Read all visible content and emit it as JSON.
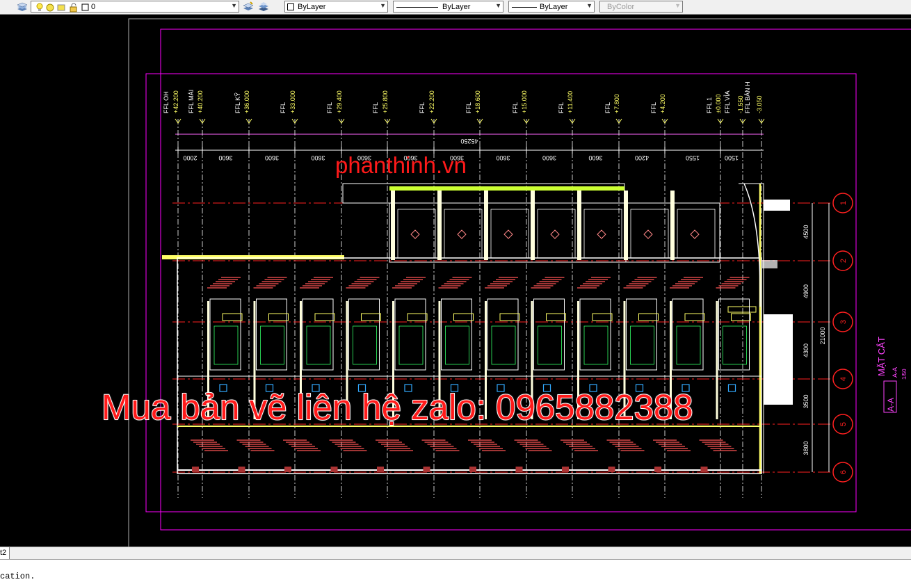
{
  "toolbar": {
    "layer_name": "0",
    "color": "ByLayer",
    "linetype": "ByLayer",
    "lineweight": "ByLayer",
    "plotstyle": "ByColor"
  },
  "drawing": {
    "levels": [
      "FFL OH",
      "+42.200",
      "FFL MÁI",
      "+40.200",
      "FFL KỸ",
      "+36.000",
      "FFL",
      "+33.000",
      "FFL",
      "+29.400",
      "FFL",
      "+25.800",
      "FFL",
      "+22.200",
      "FFL",
      "+18.600",
      "FFL",
      "+15.000",
      "FFL",
      "+11.400",
      "FFL",
      "+7.800",
      "FFL",
      "+4.200",
      "FFL 1",
      "±0.000",
      "FFL VỈA",
      "-1.550",
      "FFL BÁN H",
      "-3.050"
    ],
    "overall_dim": "45250",
    "bay_dims": [
      "2000",
      "3600",
      "3600",
      "3600",
      "3600",
      "3600",
      "3600",
      "3600",
      "3600",
      "3600",
      "4200",
      "1550",
      "1500"
    ],
    "grid_labels": [
      "1",
      "2",
      "3",
      "4",
      "5",
      "6"
    ],
    "side_dims": [
      "4500",
      "4900",
      "4300",
      "3500",
      "3800"
    ],
    "total_side_dim": "21000",
    "section_title": "MẶT CẮT",
    "section_label": "A-A",
    "section_sub": "A-A",
    "scale": "1/50"
  },
  "watermark": {
    "site": "phanthinh.vn",
    "contact": "Mua bản vẽ liên hệ zalo: 0965882388"
  },
  "tabs": {
    "layout2": "t2"
  },
  "command_line": {
    "text": "cation."
  },
  "colors": {
    "background": "#000000",
    "magenta": "#ff00ff",
    "red": "#ff2020",
    "yellow": "#ffff66",
    "cyan": "#00ffff",
    "green": "#00ff00",
    "white": "#ffffff"
  }
}
